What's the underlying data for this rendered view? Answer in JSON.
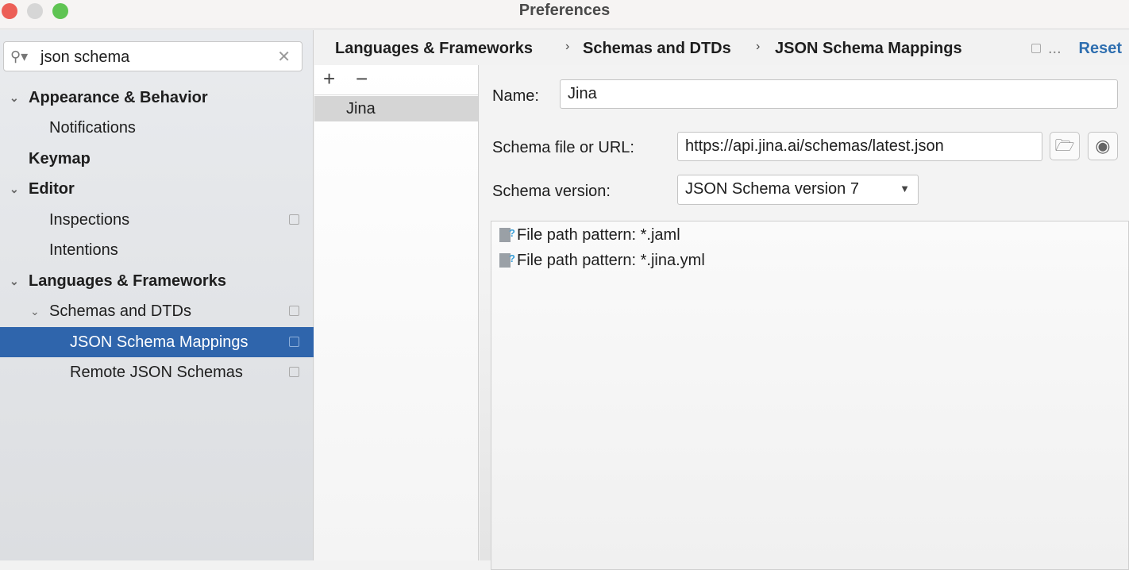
{
  "window": {
    "title": "Preferences"
  },
  "sidebar": {
    "search": {
      "value": "json schema"
    },
    "items": [
      {
        "label": "Appearance & Behavior"
      },
      {
        "label": "Notifications"
      },
      {
        "label": "Keymap"
      },
      {
        "label": "Editor"
      },
      {
        "label": "Inspections"
      },
      {
        "label": "Intentions"
      },
      {
        "label": "Languages & Frameworks"
      },
      {
        "label": "Schemas and DTDs"
      },
      {
        "label": "JSON Schema Mappings"
      },
      {
        "label": "Remote JSON Schemas"
      }
    ]
  },
  "header": {
    "breadcrumb": [
      "Languages & Frameworks",
      "Schemas and DTDs",
      "JSON Schema Mappings"
    ],
    "sep": "›",
    "more": "...",
    "reset": "Reset"
  },
  "mappings": {
    "add": "+",
    "remove": "−",
    "items": [
      "Jina"
    ]
  },
  "form": {
    "name_label": "Name:",
    "name_value": "Jina",
    "schema_label": "Schema file or URL:",
    "schema_value": "https://api.jina.ai/schemas/latest.json",
    "version_label": "Schema version:",
    "version_value": "JSON Schema version 7",
    "patterns": [
      "File path pattern: *.jaml",
      "File path pattern: *.jina.yml"
    ]
  }
}
